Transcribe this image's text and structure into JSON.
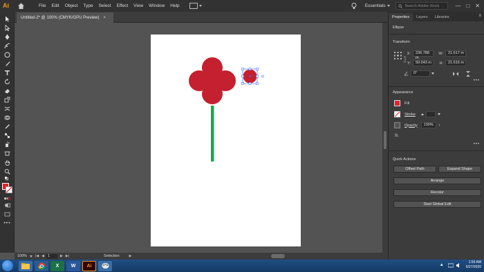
{
  "app": {
    "logo": "Ai",
    "menu": [
      "File",
      "Edit",
      "Object",
      "Type",
      "Select",
      "Effect",
      "View",
      "Window",
      "Help"
    ],
    "workspace": "Essentials",
    "stock_search_placeholder": "Search Adobe Stock",
    "window_controls": [
      "—",
      "□",
      "✕"
    ]
  },
  "document": {
    "tab_title": "Untitled-2* @ 100% (CMYK/GPU Preview)",
    "close": "×"
  },
  "status": {
    "zoom": "100%",
    "page": "1",
    "tool": "Selection"
  },
  "panel": {
    "tabs": [
      "Properties",
      "Layers",
      "Libraries"
    ],
    "selection_type": "Ellipse",
    "transform": {
      "title": "Transform",
      "x_label": "X:",
      "x_value": "236.788 m",
      "y_label": "Y:",
      "y_value": "50.043 m",
      "w_label": "W:",
      "w_value": "21.617 m",
      "h_label": "H:",
      "h_value": "21.616 m",
      "angle": "0°"
    },
    "appearance": {
      "title": "Appearance",
      "fill_label": "Fill",
      "stroke_label": "Stroke",
      "opacity_label": "Opacity",
      "opacity_value": "100%",
      "fx_label": "fx."
    },
    "quick_actions": {
      "title": "Quick Actions",
      "offset_path": "Offset Path",
      "expand_shape": "Expand Shape",
      "arrange": "Arrange",
      "recolor": "Recolor",
      "start_global_edit": "Start Global Edit"
    }
  },
  "taskbar": {
    "time": "1:56 AM",
    "date": "6/27/2020"
  },
  "colors": {
    "fill": "#d0242f",
    "stem": "#1aa84f",
    "accent_orange": "#f29a1c"
  }
}
